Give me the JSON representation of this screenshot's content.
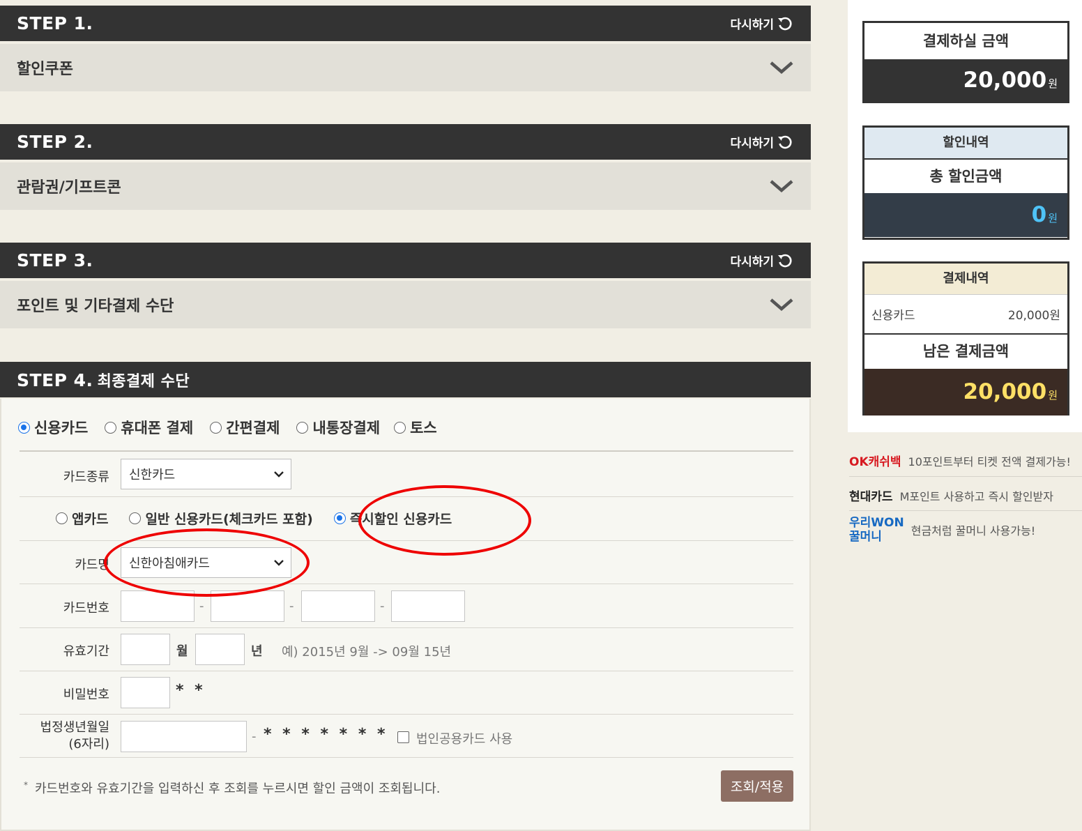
{
  "steps": [
    {
      "title": "STEP 1.",
      "retry": "다시하기",
      "row": "할인쿠폰"
    },
    {
      "title": "STEP 2.",
      "retry": "다시하기",
      "row": "관람권/기프트콘"
    },
    {
      "title": "STEP 3.",
      "retry": "다시하기",
      "row": "포인트 및 기타결제 수단"
    }
  ],
  "step4": {
    "title": "STEP 4.",
    "subtitle": "최종결제 수단",
    "pay_methods": [
      "신용카드",
      "휴대폰 결제",
      "간편결제",
      "내통장결제",
      "토스"
    ],
    "selected_method": "신용카드",
    "card_type_label": "카드종류",
    "card_type_value": "신한카드",
    "card_kinds": [
      "앱카드",
      "일반 신용카드(체크카드 포함)",
      "즉시할인 신용카드"
    ],
    "selected_card_kind": "즉시할인 신용카드",
    "card_name_label": "카드명",
    "card_name_value": "신한아침애카드",
    "card_number_label": "카드번호",
    "dash": "-",
    "expiry_label": "유효기간",
    "month_unit": "월",
    "year_unit": "년",
    "expiry_hint": "예) 2015년 9월 -> 09월 15년",
    "password_label": "비밀번호",
    "password_mask": "* *",
    "birth_label_1": "법정생년월일",
    "birth_label_2": "(6자리)",
    "birth_mask": "* * * * * * *",
    "corp_card_label": "법인공용카드 사용",
    "notice": "카드번호와 유효기간을 입력하신 후 조회를 누르시면 할인 금액이 조회됩니다.",
    "apply_button": "조회/적용"
  },
  "summary": {
    "pay_amount_label": "결제하실 금액",
    "pay_amount": "20,000",
    "won": "원",
    "discount_header": "할인내역",
    "total_discount_label": "총 할인금액",
    "total_discount": "0",
    "payment_header": "결제내역",
    "payment_item_label": "신용카드",
    "payment_item_value": "20,000원",
    "remaining_label": "남은 결제금액",
    "remaining_amount": "20,000"
  },
  "promos": [
    {
      "brand": "OK캐쉬백",
      "text": "10포인트부터 티켓 전액 결제가능!",
      "brand_color": "#d71920"
    },
    {
      "brand": "현대카드",
      "text": "M포인트 사용하고 즉시 할인받자",
      "brand_color": "#222222"
    },
    {
      "brand_line1": "우리WON",
      "brand_line2": "꿀머니",
      "text": "현금처럼 꿀머니 사용가능!",
      "brand_color": "#1769c2"
    }
  ],
  "colors": {
    "accent_radio": "#1a73e8",
    "step_bar": "#333333",
    "apply_button": "#8d6e63",
    "annotation": "#ee0000",
    "discount_amount": "#4fc3f7",
    "remaining_amount": "#ffe066"
  }
}
